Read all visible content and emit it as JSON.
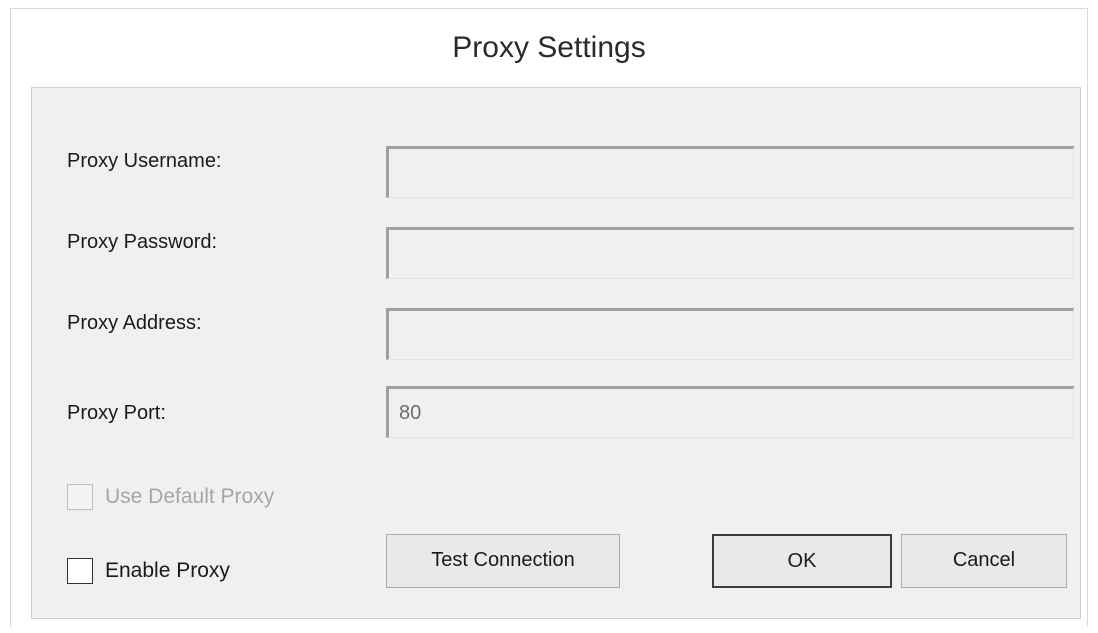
{
  "dialog": {
    "title": "Proxy Settings"
  },
  "fields": {
    "username": {
      "label": "Proxy Username:",
      "value": ""
    },
    "password": {
      "label": "Proxy Password:",
      "value": ""
    },
    "address": {
      "label": "Proxy Address:",
      "value": ""
    },
    "port": {
      "label": "Proxy Port:",
      "value": "80"
    }
  },
  "checkboxes": {
    "use_default_proxy": {
      "label": "Use Default Proxy",
      "checked": false,
      "enabled": false
    },
    "enable_proxy": {
      "label": "Enable Proxy",
      "checked": false,
      "enabled": true
    }
  },
  "buttons": {
    "test_connection": "Test Connection",
    "ok": "OK",
    "cancel": "Cancel"
  }
}
